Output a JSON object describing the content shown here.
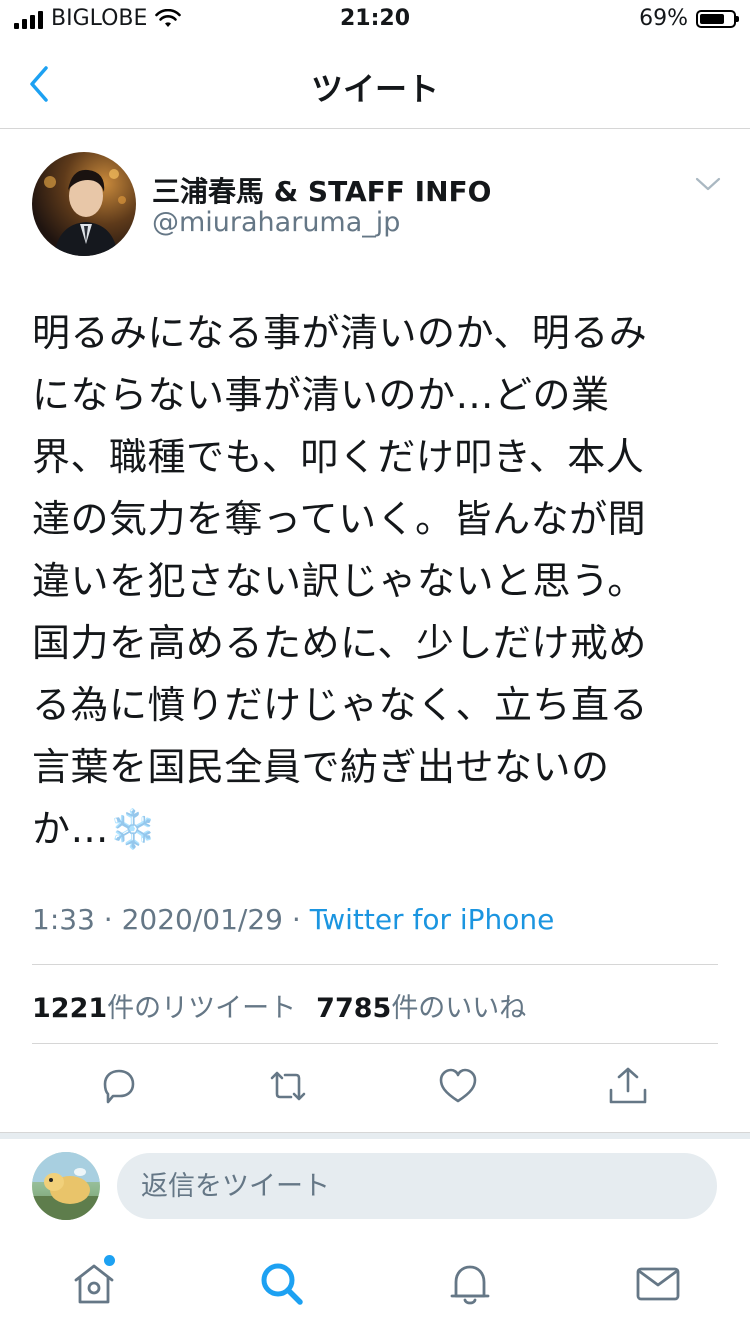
{
  "status_bar": {
    "carrier": "BIGLOBE",
    "time": "21:20",
    "battery": "69%"
  },
  "header": {
    "title": "ツイート"
  },
  "tweet": {
    "author_name": "三浦春馬 & STAFF INFO",
    "author_handle": "@miuraharuma_jp",
    "lines": [
      "明るみになる事が清いのか、明るみ",
      "にならない事が清いのか…どの業",
      "界、職種でも、叩くだけ叩き、本人",
      "達の気力を奪っていく。皆んなが間",
      "違いを犯さない訳じゃないと思う。",
      "国力を高めるために、少しだけ戒め",
      "る為に憤りだけじゃなく、立ち直る",
      "言葉を国民全員で紡ぎ出せないの",
      "か…"
    ],
    "emoji": "❄️",
    "time": "1:33",
    "date": "2020/01/29",
    "separator": "·",
    "source": "Twitter for iPhone",
    "retweet_count": "1221",
    "retweet_label": "件のリツイート",
    "like_count": "7785",
    "like_label": "件のいいね"
  },
  "reply": {
    "placeholder": "返信をツイート"
  },
  "icons": [
    "back-chevron-icon",
    "chevron-down-icon",
    "reply-icon",
    "retweet-icon",
    "like-icon",
    "share-icon",
    "home-icon",
    "search-icon",
    "notifications-icon",
    "messages-icon"
  ],
  "colors": {
    "accent": "#1da1f2",
    "link": "#1b95e0",
    "muted": "#657786",
    "text": "#14171a",
    "divider": "#d6d6d6"
  }
}
